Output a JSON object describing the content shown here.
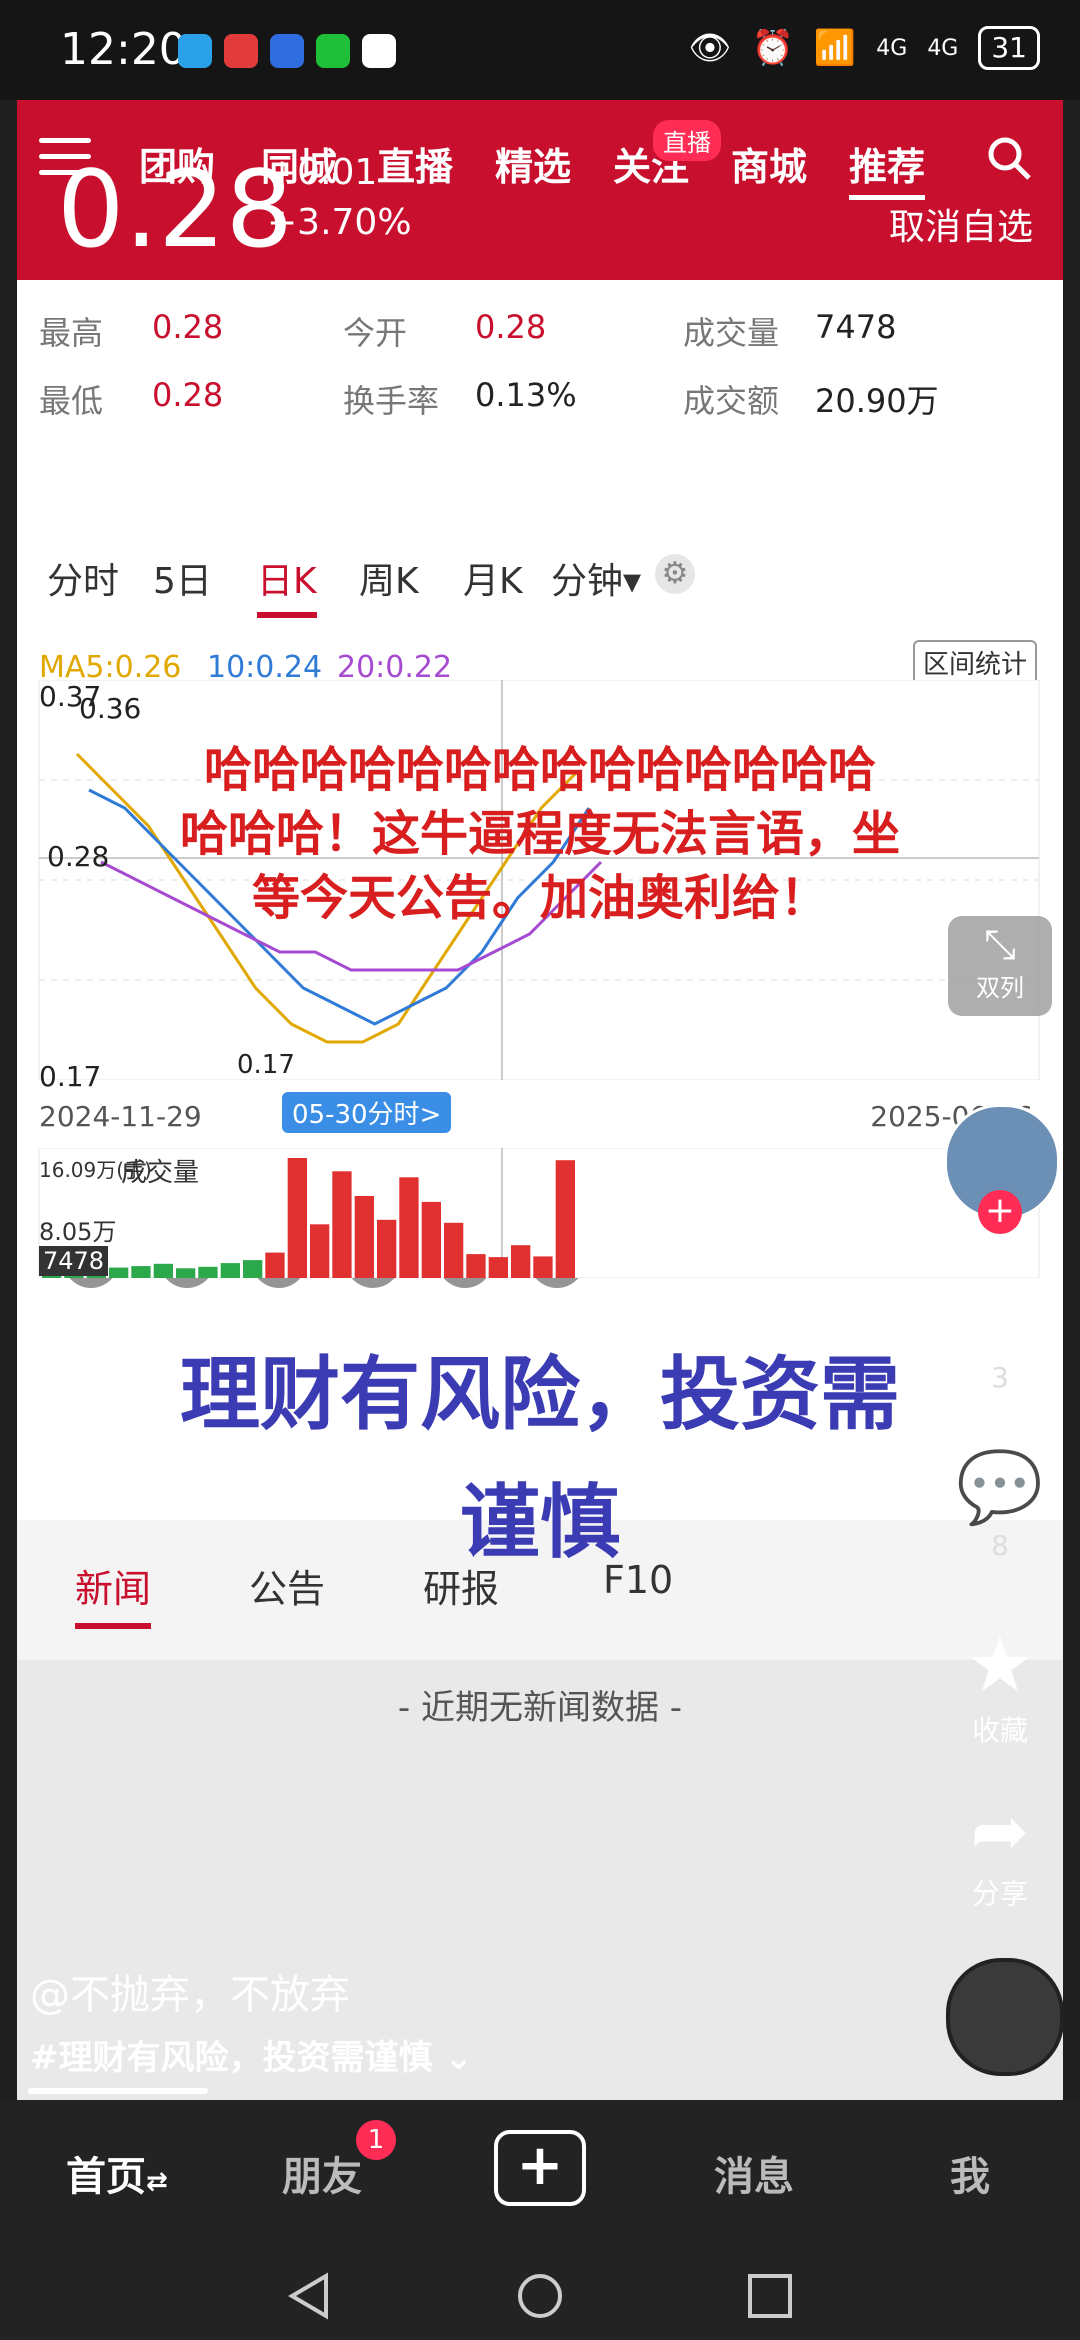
{
  "status_bar": {
    "time": "12:20",
    "battery": "31",
    "network1": "4G",
    "network2": "4G"
  },
  "quote": {
    "price": "0.28",
    "change": "+0.01",
    "change_pct": "+3.70%",
    "unfavorite": "取消自选",
    "top_nav": [
      "团购",
      "同城",
      "直播",
      "精选",
      "关注",
      "商城",
      "推荐"
    ],
    "live_badge": "直播",
    "stats": {
      "high_label": "最高",
      "high": "0.28",
      "open_label": "今开",
      "open": "0.28",
      "volume_label": "成交量",
      "volume": "7478",
      "low_label": "最低",
      "low": "0.28",
      "turnover_label": "换手率",
      "turnover": "0.13%",
      "amount_label": "成交额",
      "amount": "20.90万"
    },
    "chart_tabs": [
      "分时",
      "5日",
      "日K",
      "周K",
      "月K",
      "分钟"
    ],
    "range_stat": "区间统计",
    "ma": {
      "ma5": "MA5:0.26",
      "ma10": "10:0.24",
      "ma20": "20:0.22"
    },
    "price_labels": {
      "top": "0.37",
      "top_marker": "0.36",
      "mid": "0.28",
      "bottom": "0.17",
      "low_marker": "0.17"
    },
    "dates": {
      "start": "2024-11-29",
      "end": "2025-06-16",
      "cursor": "05-30分时>"
    },
    "volume_panel": {
      "max": "16.09万(手)",
      "title": "成交量",
      "mid": "8.05万",
      "current": "7478"
    },
    "news_tabs": [
      "新闻",
      "公告",
      "研报",
      "F10"
    ],
    "no_news": "- 近期无新闻数据 -"
  },
  "overlays": {
    "red_line1": "哈哈哈哈哈哈哈哈哈哈哈哈哈哈",
    "red_line2": "哈哈哈！这牛逼程度无法言语，坐",
    "red_line3": "等今天公告。加油奥利给！",
    "blue_line1": "理财有风险，投资需",
    "blue_line2": "谨慎"
  },
  "side": {
    "dual": "双列",
    "likes": "3",
    "comments": "8",
    "favorite": "收藏",
    "share": "分享"
  },
  "caption": {
    "author": "@不抛弃，不放弃",
    "tag": "#理财有风险，投资需谨慎"
  },
  "bottom_nav": {
    "home": "首页",
    "friends": "朋友",
    "friends_badge": "1",
    "messages": "消息",
    "me": "我"
  },
  "chart_data": {
    "type": "line",
    "title": "",
    "series": [
      {
        "name": "MA5",
        "color": "#e0a800",
        "values": [
          0.34,
          0.32,
          0.3,
          0.27,
          0.24,
          0.21,
          0.19,
          0.18,
          0.18,
          0.19,
          0.22,
          0.25,
          0.28,
          0.31,
          0.33
        ]
      },
      {
        "name": "10",
        "color": "#2f7bd6",
        "values": [
          0.32,
          0.31,
          0.29,
          0.27,
          0.25,
          0.23,
          0.21,
          0.2,
          0.19,
          0.2,
          0.21,
          0.23,
          0.26,
          0.28,
          0.31
        ]
      },
      {
        "name": "20",
        "color": "#a64bd1",
        "values": [
          0.28,
          0.27,
          0.26,
          0.25,
          0.24,
          0.23,
          0.23,
          0.22,
          0.22,
          0.22,
          0.22,
          0.23,
          0.24,
          0.26,
          0.28
        ]
      }
    ],
    "ylim": [
      0.17,
      0.37
    ],
    "volume": [
      0.5,
      0.8,
      1.1,
      1.4,
      1.6,
      1.9,
      1.3,
      1.5,
      2.0,
      2.4,
      3.4,
      16.09,
      7.2,
      14.3,
      11.0,
      7.8,
      13.5,
      10.2,
      7.4,
      3.2,
      2.8,
      4.4,
      2.9,
      15.8
    ]
  }
}
